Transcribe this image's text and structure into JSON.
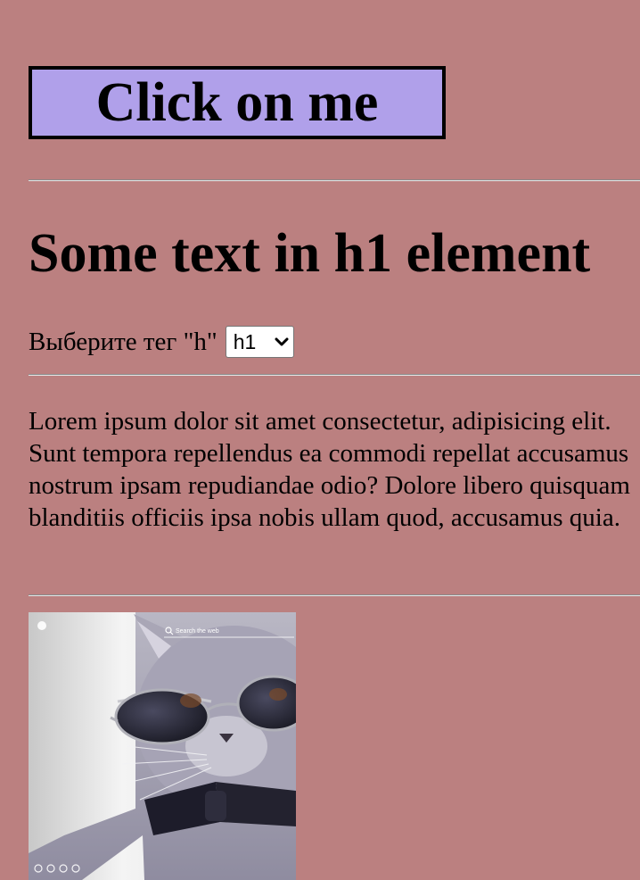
{
  "button": {
    "label": "Click on me"
  },
  "heading": {
    "text": "Some text in h1 element"
  },
  "selector": {
    "label": "Выберите тег \"h\"",
    "selected": "h1"
  },
  "paragraph": {
    "text": "Lorem ipsum dolor sit amet consectetur, adipisicing elit. Sunt tempora repellendus ea commodi repellat accusamus nostrum ipsam repudiandae odio? Dolore libero quisquam blanditiis officiis ipsa nobis ullam quod, accusamus quia."
  },
  "image": {
    "subject": "cat-with-sunglasses-and-bowtie",
    "search_placeholder": "Search the web"
  },
  "colors": {
    "page_background": "#bb8080",
    "button_background": "#b0a0ea",
    "button_border": "#000000"
  }
}
